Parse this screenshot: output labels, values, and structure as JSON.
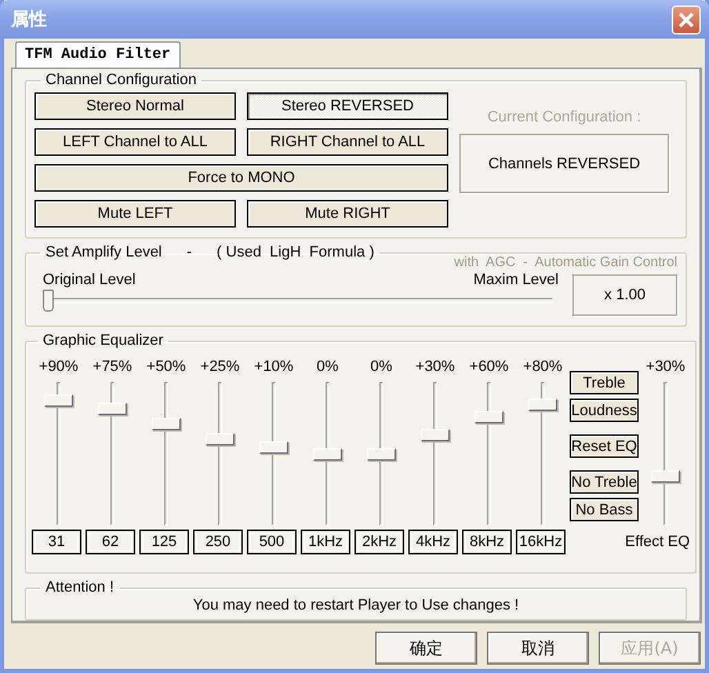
{
  "window": {
    "title": "属性"
  },
  "tabs": [
    {
      "label": "TFM Audio Filter",
      "selected": true
    }
  ],
  "channel_configuration": {
    "title": "Channel Configuration",
    "buttons": [
      {
        "label": "Stereo Normal",
        "selected": false,
        "kind": "half"
      },
      {
        "label": "Stereo REVERSED",
        "selected": true,
        "kind": "half"
      },
      {
        "label": "LEFT Channel to ALL",
        "selected": false,
        "kind": "half"
      },
      {
        "label": "RIGHT Channel to ALL",
        "selected": false,
        "kind": "half"
      },
      {
        "label": "Force to MONO",
        "selected": false,
        "kind": "wide"
      },
      {
        "label": "Mute LEFT",
        "selected": false,
        "kind": "half"
      },
      {
        "label": "Mute RIGHT",
        "selected": false,
        "kind": "half"
      }
    ],
    "current_label": "Current Configuration :",
    "current_value": "Channels REVERSED"
  },
  "amplify": {
    "title": "Set Amplify Level",
    "separator": "-",
    "formula": "( Used  LigH  Formula )",
    "agc": "with  AGC  -  Automatic Gain Control",
    "min_label": "Original Level",
    "max_label": "Maxim Level",
    "level": 0,
    "reading": "x 1.00"
  },
  "equalizer": {
    "title": "Graphic Equalizer",
    "bands": [
      {
        "gain": "+90%",
        "level": 0.91,
        "frequency": "31"
      },
      {
        "gain": "+75%",
        "level": 0.84,
        "frequency": "62"
      },
      {
        "gain": "+50%",
        "level": 0.73,
        "frequency": "125"
      },
      {
        "gain": "+25%",
        "level": 0.61,
        "frequency": "250"
      },
      {
        "gain": "+10%",
        "level": 0.55,
        "frequency": "500"
      },
      {
        "gain": "0%",
        "level": 0.5,
        "frequency": "1kHz"
      },
      {
        "gain": "0%",
        "level": 0.5,
        "frequency": "2kHz"
      },
      {
        "gain": "+30%",
        "level": 0.64,
        "frequency": "4kHz"
      },
      {
        "gain": "+60%",
        "level": 0.78,
        "frequency": "8kHz"
      },
      {
        "gain": "+80%",
        "level": 0.87,
        "frequency": "16kHz"
      }
    ],
    "preset_groups": [
      [
        "Treble",
        "Loudness"
      ],
      [
        "Reset EQ"
      ],
      [
        "No Treble",
        "No Bass"
      ]
    ],
    "effect": {
      "gain": "+30%",
      "level": 0.33,
      "label": "Effect EQ"
    }
  },
  "attention": {
    "title": "Attention !",
    "message": "You may need to restart Player to Use changes !"
  },
  "buttons": [
    {
      "label": "确定",
      "disabled": false
    },
    {
      "label": "取消",
      "disabled": false
    },
    {
      "label": "应用(A)",
      "disabled": true
    }
  ]
}
